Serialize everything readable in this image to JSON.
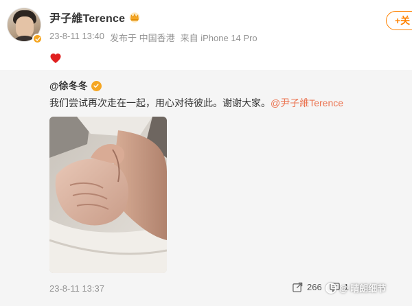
{
  "post": {
    "author": "尹子維Terence",
    "timestamp": "23-8-11 13:40",
    "source_from": "发布于 中国香港",
    "device": "来自 iPhone 14 Pro",
    "follow_label": "+关",
    "content_icon": "heart-icon",
    "crown_icon": "crown-icon"
  },
  "repost": {
    "author": "@徐冬冬",
    "text": "我们尝试再次走在一起，用心对待彼此。谢谢大家。",
    "mention": "@尹子維Terence",
    "timestamp": "23-8-11 13:37",
    "share_count": "266",
    "comment_count": "1"
  },
  "watermark": {
    "text": "@ 晴朗细节"
  },
  "colors": {
    "accent": "#ff8200",
    "mention": "#eb7350",
    "verified_gold": "#f5a623",
    "heart": "#e02020",
    "repost_bg": "#f5f5f5",
    "meta_gray": "#939393"
  }
}
